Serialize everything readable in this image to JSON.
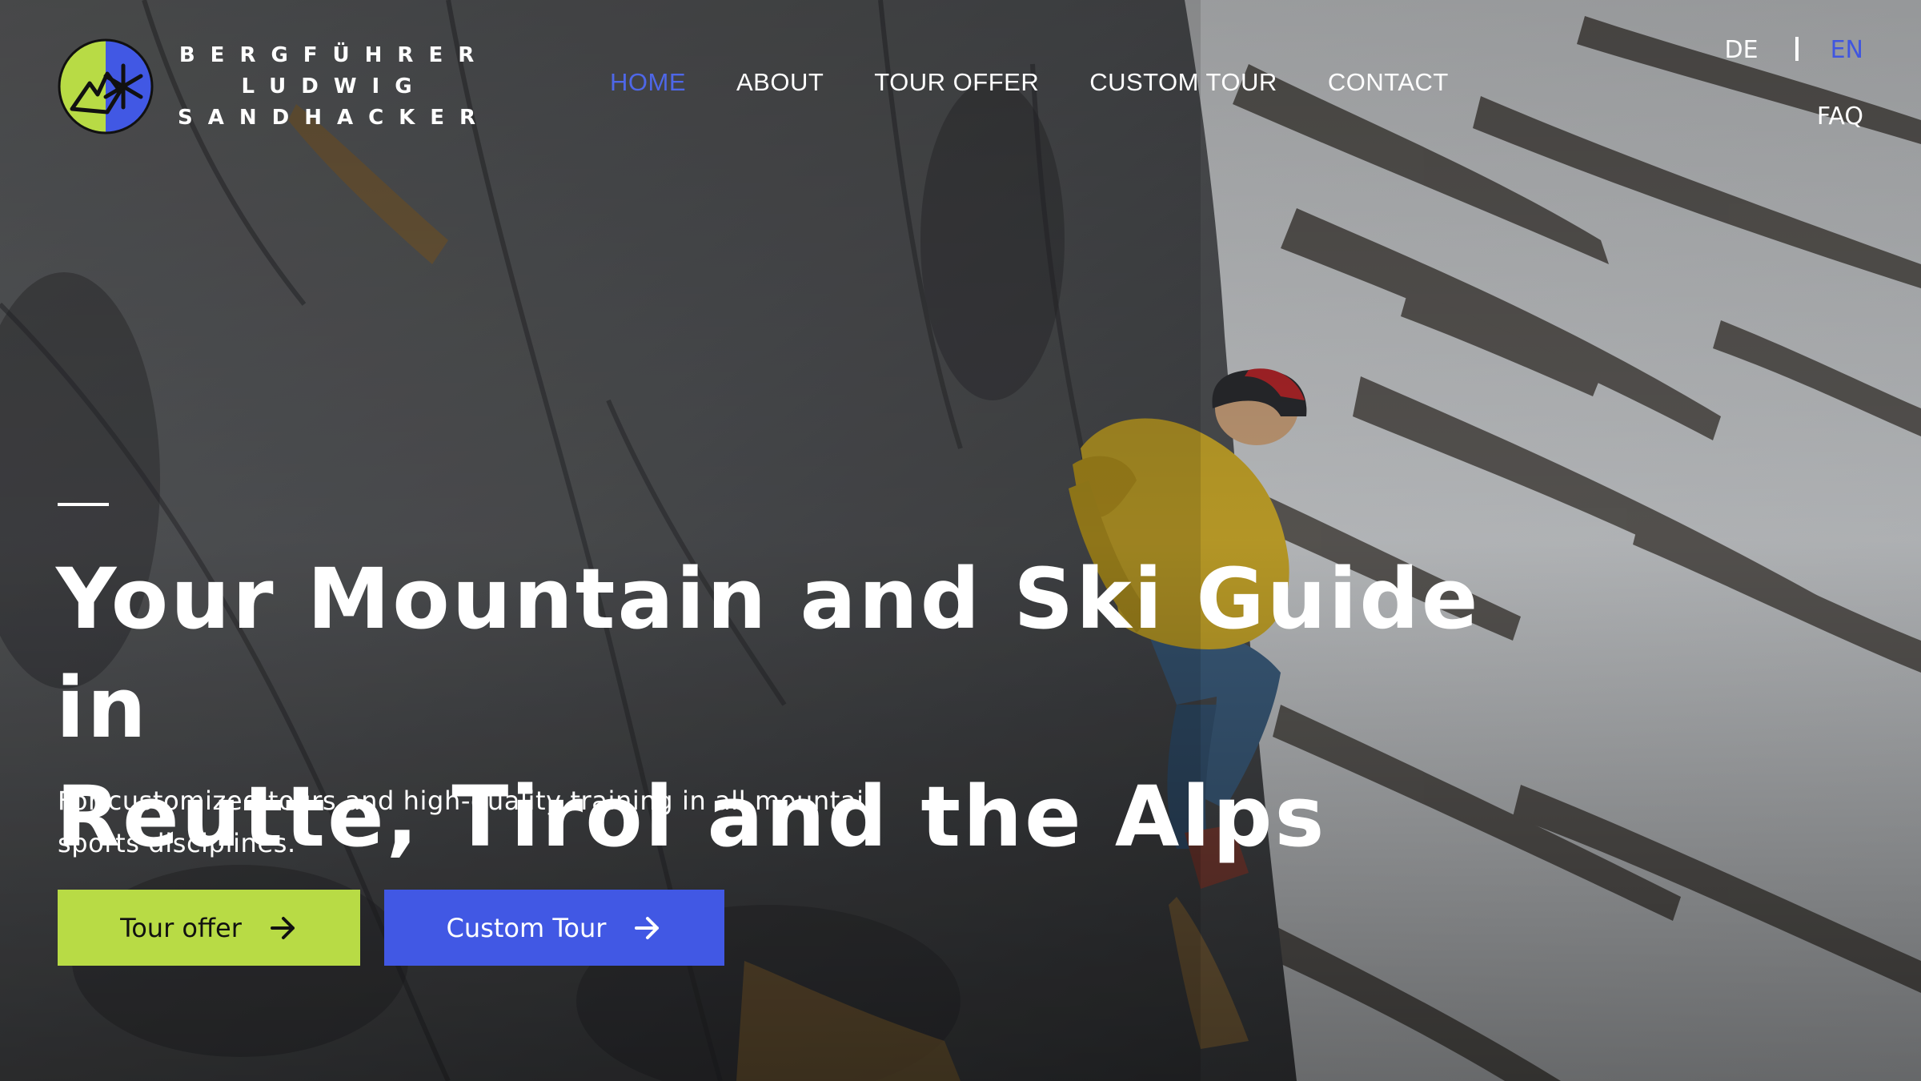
{
  "brand": {
    "logo_icon": "mountain-snowflake-logo-icon",
    "name_lines": [
      "BERGFÜHRER",
      "LUDWIG",
      "SANDHACKER"
    ],
    "colors": {
      "lime": "#b8db45",
      "blue": "#4158e4"
    }
  },
  "nav": {
    "items": [
      {
        "label": "HOME",
        "active": true
      },
      {
        "label": "ABOUT",
        "active": false
      },
      {
        "label": "TOUR OFFER",
        "active": false
      },
      {
        "label": "CUSTOM TOUR",
        "active": false
      },
      {
        "label": "CONTACT",
        "active": false
      }
    ],
    "active_color": "#4e67e8"
  },
  "language": {
    "options": [
      "DE",
      "EN"
    ],
    "selected": "EN",
    "faq_label": "FAQ"
  },
  "hero": {
    "title_line_1": "Your Mountain and Ski Guide in",
    "title_line_2": "Reutte, Tirol and the Alps",
    "subtitle_line_1": "For customized tours and high-quality training in all mountain",
    "subtitle_line_2": "sports disciplines.",
    "buttons": [
      {
        "label": "Tour offer",
        "icon": "arrow-right-icon",
        "color": "#b8db45"
      },
      {
        "label": "Custom Tour",
        "icon": "arrow-right-icon",
        "color": "#4158e4"
      }
    ]
  }
}
